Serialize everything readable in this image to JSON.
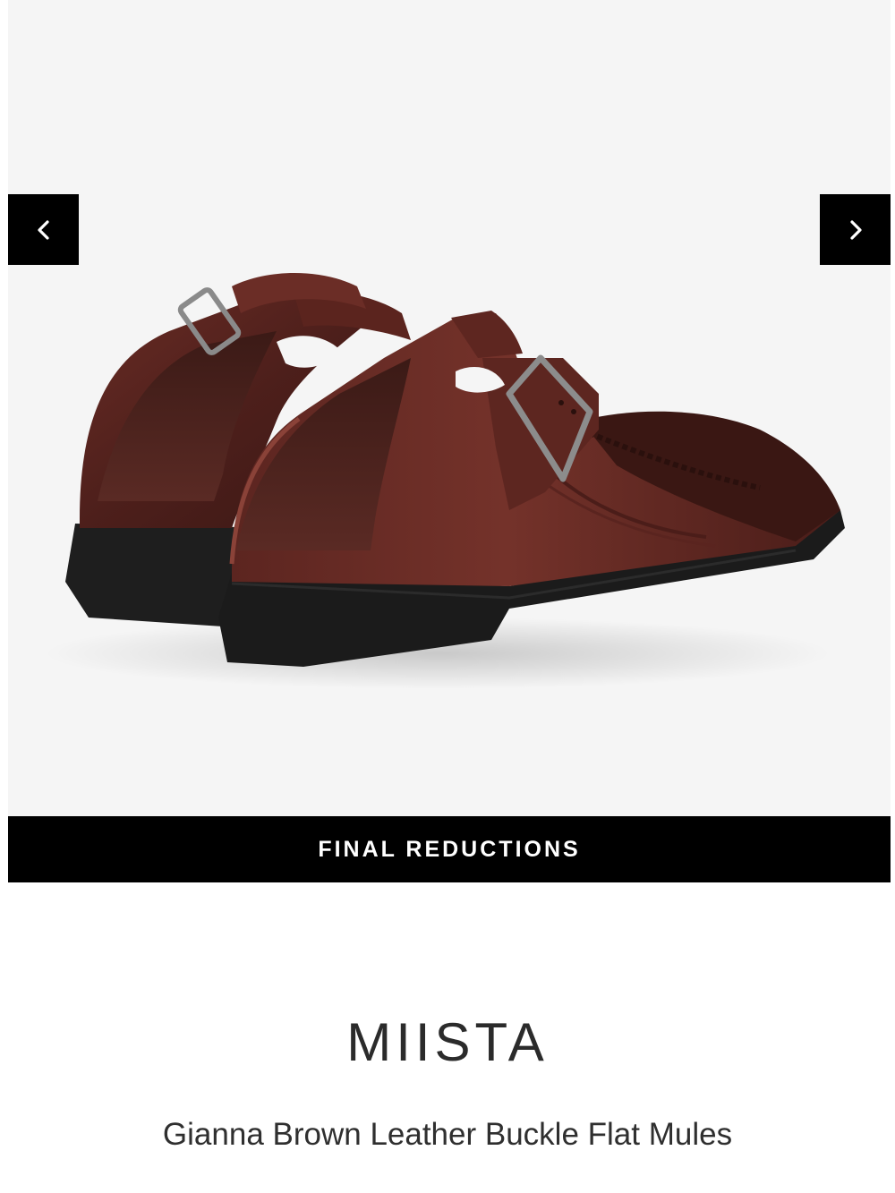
{
  "gallery": {
    "image_alt": "Gianna Brown Leather Buckle Flat Mules",
    "prev_icon": "chevron-left-icon",
    "next_icon": "chevron-right-icon"
  },
  "promo": {
    "label": "FINAL REDUCTIONS"
  },
  "product": {
    "brand": "MIISTA",
    "name": "Gianna Brown Leather Buckle Flat Mules"
  },
  "colors": {
    "background": "#f5f5f5",
    "banner": "#000000",
    "leather": "#5a2620",
    "sole": "#1c1c1c"
  }
}
